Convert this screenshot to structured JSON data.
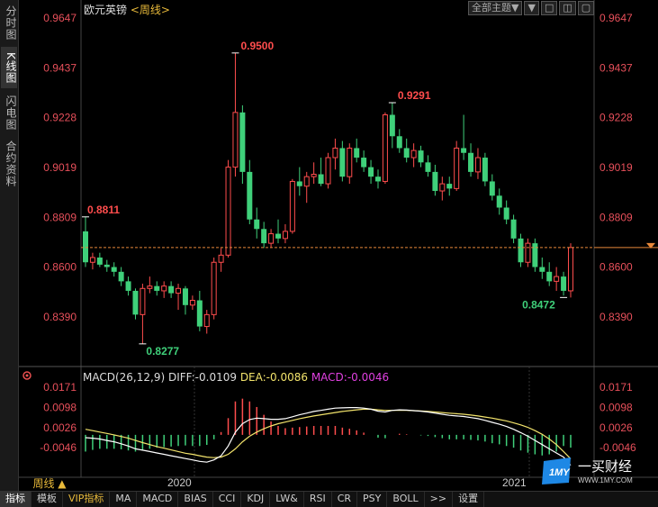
{
  "sidebar": {
    "tabs": [
      {
        "label": "分时图",
        "active": false
      },
      {
        "label": "K线图",
        "active": true
      },
      {
        "label": "闪电图",
        "active": false
      },
      {
        "label": "合约资料",
        "active": false
      }
    ]
  },
  "header": {
    "instrument": "欧元英镑",
    "cycle": "<周线>",
    "theme_select": "全部主题▼",
    "window_buttons": [
      "▼",
      "□",
      "◫",
      "▢"
    ]
  },
  "price_axis": {
    "labels": [
      "0.9647",
      "0.9437",
      "0.9228",
      "0.9019",
      "0.8809",
      "0.8600",
      "0.8390"
    ]
  },
  "macd": {
    "label": "MACD(26,12,9)",
    "diff": "DIFF:-0.0109",
    "dea": "DEA:-0.0086",
    "macd": "MACD:-0.0046",
    "axis_labels": [
      "0.0171",
      "0.0098",
      "0.0026",
      "-0.0046"
    ]
  },
  "annotations": {
    "high_2020": "0.9500",
    "start": "0.8811",
    "low_2020": "0.8277",
    "high_mid": "0.9291",
    "low_end": "0.8472"
  },
  "time_axis": [
    "2020",
    "2021"
  ],
  "period_button": "周线 ▲",
  "bottom_tabs": [
    {
      "label": "指标",
      "active": true
    },
    {
      "label": "模板"
    },
    {
      "label": "VIP指标",
      "vip": true
    },
    {
      "label": "MA"
    },
    {
      "label": "MACD"
    },
    {
      "label": "BIAS"
    },
    {
      "label": "CCI"
    },
    {
      "label": "KDJ"
    },
    {
      "label": "LW&"
    },
    {
      "label": "RSI"
    },
    {
      "label": "CR"
    },
    {
      "label": "PSY"
    },
    {
      "label": "BOLL"
    },
    {
      "label": ">>"
    },
    {
      "label": "设置"
    }
  ],
  "logo": {
    "mark": "1MY",
    "name": "一买财经",
    "url": "WWW.1MY.COM"
  },
  "colors": {
    "up": "#ff4d4d",
    "down": "#3fd07a",
    "dea": "#f2e36b",
    "macd_label": "#e040e0",
    "axis": "#e8505b",
    "accent": "#e8b93a"
  },
  "chart_data": {
    "type": "candlestick",
    "current_price": 0.8682,
    "price_axis_ticks": [
      0.9647,
      0.9437,
      0.9228,
      0.9019,
      0.8809,
      0.86,
      0.839
    ],
    "candles_ohlc": [
      [
        0.875,
        0.8811,
        0.86,
        0.862
      ],
      [
        0.862,
        0.866,
        0.859,
        0.864
      ],
      [
        0.864,
        0.866,
        0.86,
        0.861
      ],
      [
        0.861,
        0.863,
        0.858,
        0.86
      ],
      [
        0.86,
        0.862,
        0.856,
        0.858
      ],
      [
        0.858,
        0.86,
        0.852,
        0.854
      ],
      [
        0.854,
        0.856,
        0.848,
        0.85
      ],
      [
        0.85,
        0.851,
        0.838,
        0.84
      ],
      [
        0.84,
        0.853,
        0.8277,
        0.851
      ],
      [
        0.851,
        0.856,
        0.849,
        0.852
      ],
      [
        0.852,
        0.854,
        0.848,
        0.85
      ],
      [
        0.85,
        0.854,
        0.847,
        0.852
      ],
      [
        0.852,
        0.854,
        0.847,
        0.849
      ],
      [
        0.849,
        0.853,
        0.842,
        0.851
      ],
      [
        0.851,
        0.852,
        0.84,
        0.844
      ],
      [
        0.844,
        0.848,
        0.842,
        0.846
      ],
      [
        0.846,
        0.85,
        0.833,
        0.835
      ],
      [
        0.835,
        0.842,
        0.832,
        0.84
      ],
      [
        0.84,
        0.864,
        0.838,
        0.862
      ],
      [
        0.862,
        0.868,
        0.858,
        0.865
      ],
      [
        0.865,
        0.905,
        0.864,
        0.902
      ],
      [
        0.902,
        0.95,
        0.898,
        0.925
      ],
      [
        0.925,
        0.928,
        0.895,
        0.9
      ],
      [
        0.9,
        0.905,
        0.878,
        0.88
      ],
      [
        0.88,
        0.885,
        0.872,
        0.876
      ],
      [
        0.876,
        0.879,
        0.868,
        0.87
      ],
      [
        0.87,
        0.876,
        0.868,
        0.874
      ],
      [
        0.874,
        0.88,
        0.87,
        0.872
      ],
      [
        0.872,
        0.878,
        0.87,
        0.875
      ],
      [
        0.875,
        0.897,
        0.874,
        0.896
      ],
      [
        0.896,
        0.902,
        0.89,
        0.894
      ],
      [
        0.894,
        0.9,
        0.887,
        0.898
      ],
      [
        0.898,
        0.904,
        0.895,
        0.899
      ],
      [
        0.899,
        0.906,
        0.894,
        0.895
      ],
      [
        0.895,
        0.908,
        0.893,
        0.906
      ],
      [
        0.906,
        0.914,
        0.901,
        0.91
      ],
      [
        0.91,
        0.913,
        0.896,
        0.898
      ],
      [
        0.898,
        0.912,
        0.895,
        0.91
      ],
      [
        0.91,
        0.914,
        0.904,
        0.906
      ],
      [
        0.906,
        0.909,
        0.9,
        0.902
      ],
      [
        0.902,
        0.905,
        0.895,
        0.898
      ],
      [
        0.898,
        0.901,
        0.893,
        0.896
      ],
      [
        0.896,
        0.925,
        0.895,
        0.924
      ],
      [
        0.924,
        0.9291,
        0.91,
        0.915
      ],
      [
        0.915,
        0.918,
        0.908,
        0.91
      ],
      [
        0.91,
        0.914,
        0.904,
        0.906
      ],
      [
        0.906,
        0.912,
        0.902,
        0.909
      ],
      [
        0.909,
        0.911,
        0.902,
        0.904
      ],
      [
        0.904,
        0.907,
        0.898,
        0.9
      ],
      [
        0.9,
        0.903,
        0.89,
        0.892
      ],
      [
        0.892,
        0.898,
        0.888,
        0.895
      ],
      [
        0.895,
        0.898,
        0.89,
        0.893
      ],
      [
        0.893,
        0.913,
        0.892,
        0.91
      ],
      [
        0.91,
        0.924,
        0.905,
        0.908
      ],
      [
        0.908,
        0.912,
        0.898,
        0.9
      ],
      [
        0.9,
        0.91,
        0.897,
        0.906
      ],
      [
        0.906,
        0.908,
        0.894,
        0.896
      ],
      [
        0.896,
        0.899,
        0.888,
        0.89
      ],
      [
        0.89,
        0.893,
        0.882,
        0.885
      ],
      [
        0.885,
        0.888,
        0.878,
        0.88
      ],
      [
        0.88,
        0.882,
        0.87,
        0.872
      ],
      [
        0.872,
        0.874,
        0.86,
        0.862
      ],
      [
        0.862,
        0.872,
        0.86,
        0.87
      ],
      [
        0.87,
        0.872,
        0.858,
        0.86
      ],
      [
        0.86,
        0.864,
        0.855,
        0.858
      ],
      [
        0.858,
        0.862,
        0.852,
        0.854
      ],
      [
        0.854,
        0.86,
        0.85,
        0.856
      ],
      [
        0.856,
        0.858,
        0.848,
        0.85
      ],
      [
        0.85,
        0.87,
        0.8472,
        0.8682
      ]
    ],
    "macd_diff": [
      -0.001,
      -0.0012,
      -0.0015,
      -0.002,
      -0.0025,
      -0.0032,
      -0.004,
      -0.005,
      -0.0055,
      -0.006,
      -0.0065,
      -0.007,
      -0.0075,
      -0.008,
      -0.0085,
      -0.009,
      -0.0095,
      -0.0098,
      -0.009,
      -0.0075,
      -0.004,
      0.001,
      0.004,
      0.0055,
      0.006,
      0.0058,
      0.0056,
      0.0056,
      0.0058,
      0.0065,
      0.0072,
      0.0078,
      0.0084,
      0.0088,
      0.0092,
      0.0096,
      0.0097,
      0.0098,
      0.0098,
      0.0096,
      0.0092,
      0.0085,
      0.0082,
      0.0088,
      0.009,
      0.0089,
      0.0087,
      0.0085,
      0.0082,
      0.0078,
      0.0074,
      0.007,
      0.0068,
      0.0066,
      0.0062,
      0.0058,
      0.0052,
      0.0045,
      0.0038,
      0.003,
      0.002,
      0.0008,
      -0.0005,
      -0.002,
      -0.0035,
      -0.005,
      -0.0065,
      -0.008,
      -0.0109
    ],
    "macd_dea": [
      0.002,
      0.0015,
      0.001,
      0.0005,
      0.0,
      -0.0006,
      -0.0012,
      -0.002,
      -0.0028,
      -0.0035,
      -0.0042,
      -0.0048,
      -0.0054,
      -0.006,
      -0.0066,
      -0.007,
      -0.0075,
      -0.008,
      -0.0082,
      -0.008,
      -0.007,
      -0.005,
      -0.0025,
      -0.0005,
      0.001,
      0.0022,
      0.0032,
      0.004,
      0.0046,
      0.0052,
      0.0058,
      0.0063,
      0.0068,
      0.0072,
      0.0076,
      0.008,
      0.0084,
      0.0087,
      0.009,
      0.0092,
      0.0092,
      0.009,
      0.0088,
      0.0088,
      0.0088,
      0.0088,
      0.0087,
      0.0086,
      0.0084,
      0.0082,
      0.008,
      0.0078,
      0.0076,
      0.0074,
      0.0071,
      0.0068,
      0.0064,
      0.006,
      0.0055,
      0.005,
      0.0043,
      0.0036,
      0.0027,
      0.0015,
      0.0002,
      -0.0015,
      -0.0035,
      -0.006,
      -0.0086
    ]
  }
}
